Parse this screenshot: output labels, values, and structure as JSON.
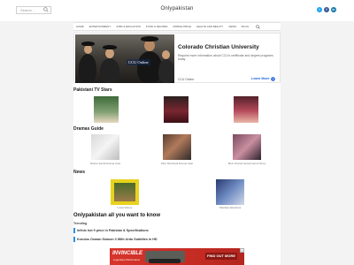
{
  "header": {
    "search_placeholder": "Search ...",
    "site_title": "Onlypakistan",
    "social": [
      {
        "name": "twitter",
        "letter": "t",
        "color": "#1da1f2"
      },
      {
        "name": "facebook",
        "letter": "f",
        "color": "#3b5998"
      },
      {
        "name": "linkedin",
        "letter": "in",
        "color": "#0e76a8"
      }
    ]
  },
  "nav": {
    "items": [
      "HOME",
      "ENTERTAINMENT",
      "JOBS & EDUCATION",
      "FOOD & RECIPES",
      "MOBILE PRICE",
      "HEALTH AND BEAUTY",
      "NEWS",
      "BLOG"
    ]
  },
  "ad_top": {
    "title": "Colorado Christian University",
    "description": "Request more information about CCU's certificate and degree programs today.",
    "brand": "CCU Online",
    "logo_text": "CCU Online",
    "cta": "Learn More"
  },
  "sections": {
    "tv_stars": "Pakistani TV Stars",
    "dramas": "Dramas Guide",
    "news": "News"
  },
  "captions": {
    "drama1": "Drama Serial Drama Cast",
    "drama2": "Meri Shehzadi Drama Cast",
    "drama3": "Mein Drama Serial Cast & Story",
    "news1": "Local Victory",
    "news2": "Pakistan Elections"
  },
  "main": {
    "heading": "Onlypakistan all you want to know",
    "trending_label": "Trending",
    "trending": [
      "Infinix hot 9 price in Pakistan & Specifications",
      "Kurulus Osman Season 3 With Urdu Subtitles in HD"
    ]
  },
  "ad_bottom": {
    "logo": "INVINCIBLE",
    "sub": "Legendary Performance",
    "cta": "FIND OUT MORE",
    "close": "×"
  }
}
